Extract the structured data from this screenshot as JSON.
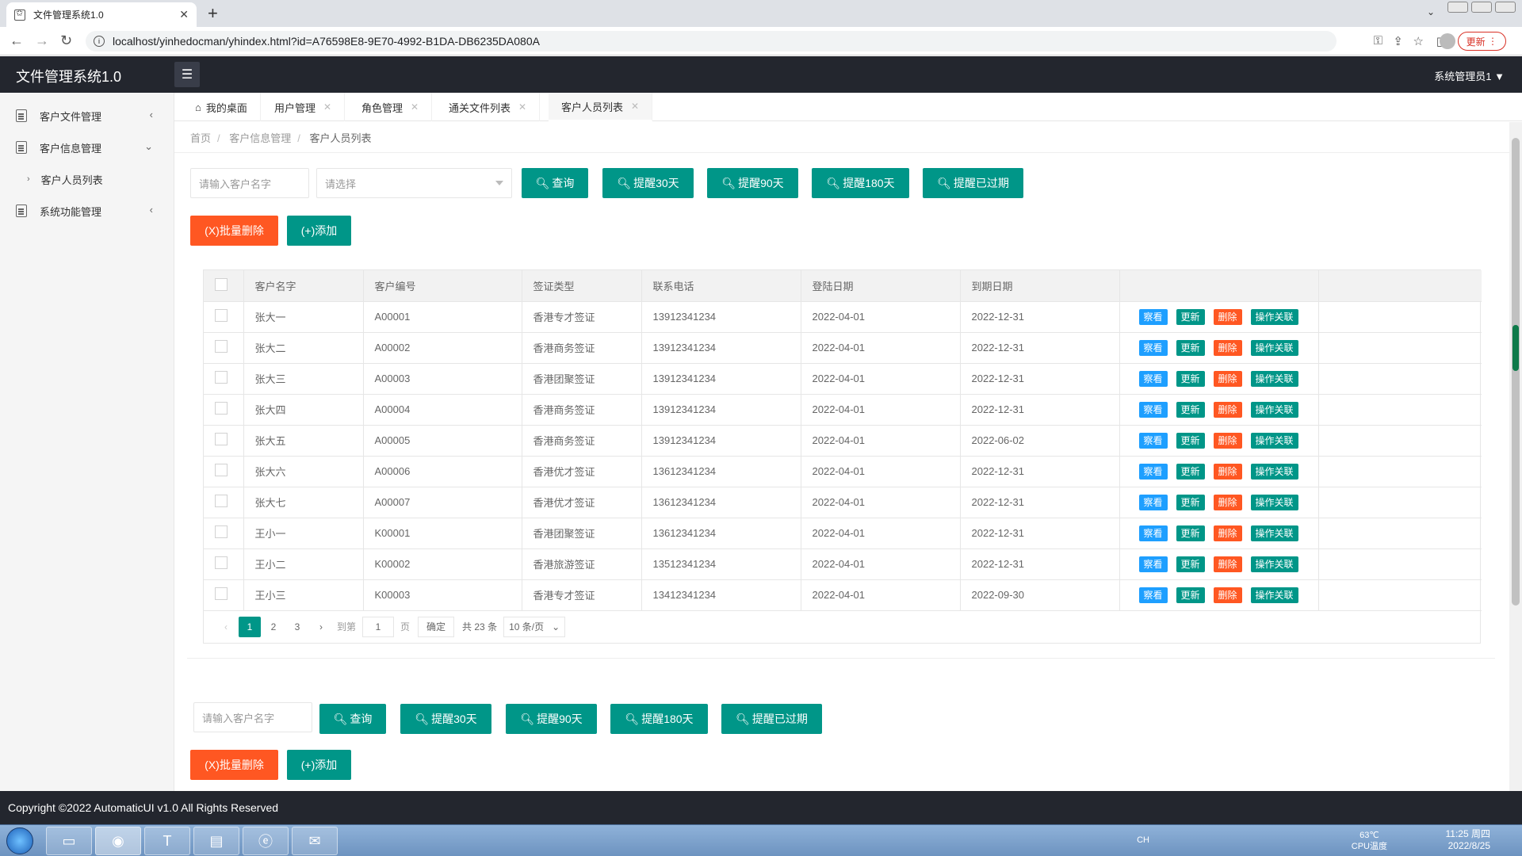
{
  "browser": {
    "tab_title": "文件管理系统1.0",
    "url": "localhost/yinhedocman/yhindex.html?id=A76598E8-9E70-4992-B1DA-DB6235DA080A",
    "update_label": "更新"
  },
  "header": {
    "logo": "文件管理系统1.0",
    "user": "系统管理员1"
  },
  "sidebar": {
    "items": [
      {
        "label": "客户文件管理",
        "arrow": "‹"
      },
      {
        "label": "客户信息管理",
        "arrow": "⌄"
      },
      {
        "label": "客户人员列表",
        "sub": true
      },
      {
        "label": "系统功能管理",
        "arrow": "‹"
      }
    ]
  },
  "tabs": [
    {
      "label": "我的桌面"
    },
    {
      "label": "用户管理"
    },
    {
      "label": "角色管理"
    },
    {
      "label": "通关文件列表"
    },
    {
      "label": "客户人员列表"
    }
  ],
  "breadcrumb": {
    "home": "首页",
    "parent": "客户信息管理",
    "current": "客户人员列表"
  },
  "search": {
    "name_placeholder": "请输入客户名字",
    "select_placeholder": "请选择",
    "query": "查询",
    "remind30": "提醒30天",
    "remind90": "提醒90天",
    "remind180": "提醒180天",
    "expired": "提醒已过期",
    "batch_delete": "(X)批量删除",
    "add": "(+)添加"
  },
  "table": {
    "headers": [
      "客户名字",
      "客户编号",
      "签证类型",
      "联系电话",
      "登陆日期",
      "到期日期"
    ],
    "actions": {
      "view": "察看",
      "update": "更新",
      "delete": "删除",
      "link": "操作关联"
    },
    "rows": [
      {
        "name": "张大一",
        "code": "A00001",
        "visa": "香港专才签证",
        "phone": "13912341234",
        "login": "2022-04-01",
        "expire": "2022-12-31"
      },
      {
        "name": "张大二",
        "code": "A00002",
        "visa": "香港商务签证",
        "phone": "13912341234",
        "login": "2022-04-01",
        "expire": "2022-12-31"
      },
      {
        "name": "张大三",
        "code": "A00003",
        "visa": "香港团聚签证",
        "phone": "13912341234",
        "login": "2022-04-01",
        "expire": "2022-12-31"
      },
      {
        "name": "张大四",
        "code": "A00004",
        "visa": "香港商务签证",
        "phone": "13912341234",
        "login": "2022-04-01",
        "expire": "2022-12-31"
      },
      {
        "name": "张大五",
        "code": "A00005",
        "visa": "香港商务签证",
        "phone": "13912341234",
        "login": "2022-04-01",
        "expire": "2022-06-02"
      },
      {
        "name": "张大六",
        "code": "A00006",
        "visa": "香港优才签证",
        "phone": "13612341234",
        "login": "2022-04-01",
        "expire": "2022-12-31"
      },
      {
        "name": "张大七",
        "code": "A00007",
        "visa": "香港优才签证",
        "phone": "13612341234",
        "login": "2022-04-01",
        "expire": "2022-12-31"
      },
      {
        "name": "王小一",
        "code": "K00001",
        "visa": "香港团聚签证",
        "phone": "13612341234",
        "login": "2022-04-01",
        "expire": "2022-12-31"
      },
      {
        "name": "王小二",
        "code": "K00002",
        "visa": "香港旅游签证",
        "phone": "13512341234",
        "login": "2022-04-01",
        "expire": "2022-12-31"
      },
      {
        "name": "王小三",
        "code": "K00003",
        "visa": "香港专才签证",
        "phone": "13412341234",
        "login": "2022-04-01",
        "expire": "2022-09-30"
      }
    ]
  },
  "pager": {
    "pages": [
      "1",
      "2",
      "3"
    ],
    "goto_label": "到第",
    "goto_value": "1",
    "page_unit": "页",
    "confirm": "确定",
    "total": "共 23 条",
    "per_page": "10 条/页"
  },
  "footer": {
    "text": "Copyright ©2022 AutomaticUI v1.0 All Rights Reserved"
  },
  "taskbar": {
    "time": "11:25 周四",
    "date": "2022/8/25",
    "temp": "63℃",
    "temp_label": "CPU温度",
    "ime": "CH"
  }
}
